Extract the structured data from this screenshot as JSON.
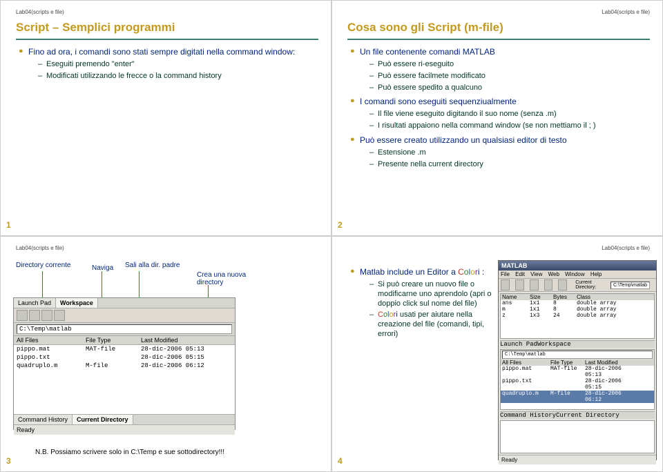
{
  "header": "Lab04(scripts e file)",
  "slide1": {
    "num": "1",
    "title": "Script – Semplici programmi",
    "b1": "Fino ad ora, i comandi sono stati sempre digitati nella command window:",
    "s1": "Eseguiti premendo \"enter\"",
    "s2": "Modificati utilizzando le frecce o la command history"
  },
  "slide2": {
    "num": "2",
    "title": "Cosa sono gli Script (m-file)",
    "b1": "Un file contenente comandi MATLAB",
    "b1s1": "Può essere ri-eseguito",
    "b1s2": "Può essere facilmete modificato",
    "b1s3": "Può essere spedito a qualcuno",
    "b2": "I comandi sono eseguiti sequenziualmente",
    "b2s1": "Il file viene eseguito digitando il suo nome (senza .m)",
    "b2s2": "I risultati appaiono nella command window (se non mettiamo il ; )",
    "b3": "Può essere creato utilizzando un qualsiasi editor di testo",
    "b3s1": "Estensione .m",
    "b3s2": "Presente nella current directory"
  },
  "slide3": {
    "num": "3",
    "a_current": "Directory corrente",
    "a_nav": "Naviga",
    "a_parent": "Sali alla dir. padre",
    "a_new": "Crea una nuova directory",
    "tabs": {
      "launch": "Launch Pad",
      "workspace": "Workspace"
    },
    "path": "C:\\Temp\\matlab",
    "cols": {
      "name": "All Files",
      "type": "File Type",
      "mod": "Last Modified"
    },
    "rows": [
      {
        "name": "pippo.mat",
        "type": "MAT-file",
        "mod": "28-dic-2006 05:13"
      },
      {
        "name": "pippo.txt",
        "type": "",
        "mod": "28-dic-2006 05:15"
      },
      {
        "name": "quadruplo.m",
        "type": "M-file",
        "mod": "28-dic-2006 06:12"
      }
    ],
    "lowertabs": {
      "hist": "Command History",
      "cd": "Current Directory"
    },
    "status": "Ready",
    "nb": "N.B. Possiamo scrivere solo in C:\\Temp e sue sottodirectory!!!"
  },
  "slide4": {
    "num": "4",
    "b1": "Matlab include un Editor a ",
    "colorword": "Colori",
    "colon": " :",
    "s1": "Si può creare un nuovo file o modificarne uno aprendolo (apri o doppio click sul nome del file)",
    "s2a": "Colori",
    "s2b": " usati per aiutare nella creazione del file (comandi, tipi, errori)",
    "win": {
      "title": "MATLAB",
      "menu": [
        "File",
        "Edit",
        "View",
        "Web",
        "Window",
        "Help"
      ],
      "cdlabel": "Current Directory:",
      "cdval": "C:\\Temp\\matlab",
      "ws": {
        "cols": [
          "Name",
          "Size",
          "Bytes",
          "Class"
        ],
        "rows": [
          [
            "ans",
            "1x1",
            "8",
            "double array"
          ],
          [
            "m",
            "1x1",
            "8",
            "double array"
          ],
          [
            "z",
            "1x3",
            "24",
            "double array"
          ]
        ]
      },
      "tabs": {
        "launch": "Launch Pad",
        "workspace": "Workspace"
      },
      "dir": {
        "path": "C:\\Temp\\matlab",
        "cols": [
          "All Files",
          "File Type",
          "Last Modified"
        ],
        "rows": [
          [
            "pippo.mat",
            "MAT-file",
            "28-dic-2006 05:13"
          ],
          [
            "pippo.txt",
            "",
            "28-dic-2006 05:15"
          ],
          [
            "quadruplo.m",
            "M-file",
            "28-dic-2006 06:12"
          ]
        ]
      },
      "lowertabs": {
        "hist": "Command History",
        "cd": "Current Directory"
      },
      "status": "Ready"
    }
  }
}
